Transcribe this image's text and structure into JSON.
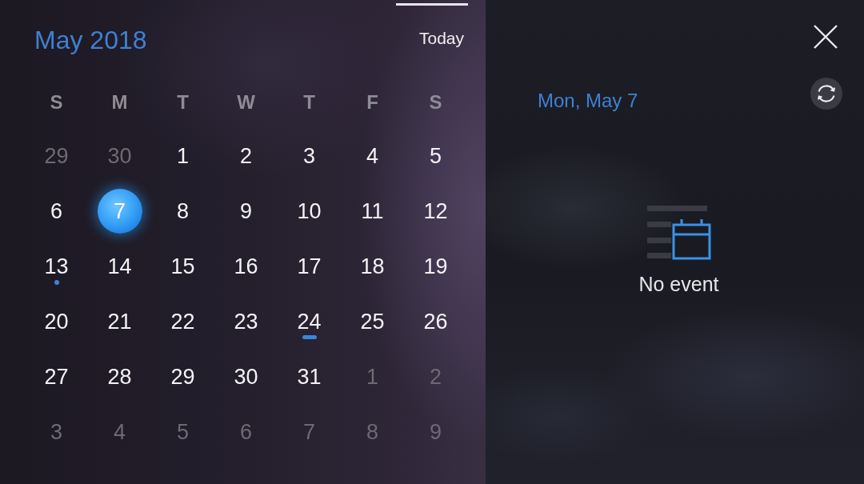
{
  "month_panel": {
    "title": "May 2018",
    "today_button": "Today",
    "weekdays": [
      "S",
      "M",
      "T",
      "W",
      "T",
      "F",
      "S"
    ],
    "days": [
      {
        "label": "29",
        "in_month": false,
        "selected": false,
        "event_dot": false,
        "event_bar": false
      },
      {
        "label": "30",
        "in_month": false,
        "selected": false,
        "event_dot": false,
        "event_bar": false
      },
      {
        "label": "1",
        "in_month": true,
        "selected": false,
        "event_dot": false,
        "event_bar": false
      },
      {
        "label": "2",
        "in_month": true,
        "selected": false,
        "event_dot": false,
        "event_bar": false
      },
      {
        "label": "3",
        "in_month": true,
        "selected": false,
        "event_dot": false,
        "event_bar": false
      },
      {
        "label": "4",
        "in_month": true,
        "selected": false,
        "event_dot": false,
        "event_bar": false
      },
      {
        "label": "5",
        "in_month": true,
        "selected": false,
        "event_dot": false,
        "event_bar": false
      },
      {
        "label": "6",
        "in_month": true,
        "selected": false,
        "event_dot": false,
        "event_bar": false
      },
      {
        "label": "7",
        "in_month": true,
        "selected": true,
        "event_dot": false,
        "event_bar": false
      },
      {
        "label": "8",
        "in_month": true,
        "selected": false,
        "event_dot": false,
        "event_bar": false
      },
      {
        "label": "9",
        "in_month": true,
        "selected": false,
        "event_dot": false,
        "event_bar": false
      },
      {
        "label": "10",
        "in_month": true,
        "selected": false,
        "event_dot": false,
        "event_bar": false
      },
      {
        "label": "11",
        "in_month": true,
        "selected": false,
        "event_dot": false,
        "event_bar": false
      },
      {
        "label": "12",
        "in_month": true,
        "selected": false,
        "event_dot": false,
        "event_bar": false
      },
      {
        "label": "13",
        "in_month": true,
        "selected": false,
        "event_dot": true,
        "event_bar": false
      },
      {
        "label": "14",
        "in_month": true,
        "selected": false,
        "event_dot": false,
        "event_bar": false
      },
      {
        "label": "15",
        "in_month": true,
        "selected": false,
        "event_dot": false,
        "event_bar": false
      },
      {
        "label": "16",
        "in_month": true,
        "selected": false,
        "event_dot": false,
        "event_bar": false
      },
      {
        "label": "17",
        "in_month": true,
        "selected": false,
        "event_dot": false,
        "event_bar": false
      },
      {
        "label": "18",
        "in_month": true,
        "selected": false,
        "event_dot": false,
        "event_bar": false
      },
      {
        "label": "19",
        "in_month": true,
        "selected": false,
        "event_dot": false,
        "event_bar": false
      },
      {
        "label": "20",
        "in_month": true,
        "selected": false,
        "event_dot": false,
        "event_bar": false
      },
      {
        "label": "21",
        "in_month": true,
        "selected": false,
        "event_dot": false,
        "event_bar": false
      },
      {
        "label": "22",
        "in_month": true,
        "selected": false,
        "event_dot": false,
        "event_bar": false
      },
      {
        "label": "23",
        "in_month": true,
        "selected": false,
        "event_dot": false,
        "event_bar": false
      },
      {
        "label": "24",
        "in_month": true,
        "selected": false,
        "event_dot": false,
        "event_bar": true
      },
      {
        "label": "25",
        "in_month": true,
        "selected": false,
        "event_dot": false,
        "event_bar": false
      },
      {
        "label": "26",
        "in_month": true,
        "selected": false,
        "event_dot": false,
        "event_bar": false
      },
      {
        "label": "27",
        "in_month": true,
        "selected": false,
        "event_dot": false,
        "event_bar": false
      },
      {
        "label": "28",
        "in_month": true,
        "selected": false,
        "event_dot": false,
        "event_bar": false
      },
      {
        "label": "29",
        "in_month": true,
        "selected": false,
        "event_dot": false,
        "event_bar": false
      },
      {
        "label": "30",
        "in_month": true,
        "selected": false,
        "event_dot": false,
        "event_bar": false
      },
      {
        "label": "31",
        "in_month": true,
        "selected": false,
        "event_dot": false,
        "event_bar": false
      },
      {
        "label": "1",
        "in_month": false,
        "selected": false,
        "event_dot": false,
        "event_bar": false
      },
      {
        "label": "2",
        "in_month": false,
        "selected": false,
        "event_dot": false,
        "event_bar": false
      },
      {
        "label": "3",
        "in_month": false,
        "selected": false,
        "event_dot": false,
        "event_bar": false
      },
      {
        "label": "4",
        "in_month": false,
        "selected": false,
        "event_dot": false,
        "event_bar": false
      },
      {
        "label": "5",
        "in_month": false,
        "selected": false,
        "event_dot": false,
        "event_bar": false
      },
      {
        "label": "6",
        "in_month": false,
        "selected": false,
        "event_dot": false,
        "event_bar": false
      },
      {
        "label": "7",
        "in_month": false,
        "selected": false,
        "event_dot": false,
        "event_bar": false
      },
      {
        "label": "8",
        "in_month": false,
        "selected": false,
        "event_dot": false,
        "event_bar": false
      },
      {
        "label": "9",
        "in_month": false,
        "selected": false,
        "event_dot": false,
        "event_bar": false
      }
    ]
  },
  "day_panel": {
    "date": "Mon, May 7",
    "empty_state": "No event"
  }
}
